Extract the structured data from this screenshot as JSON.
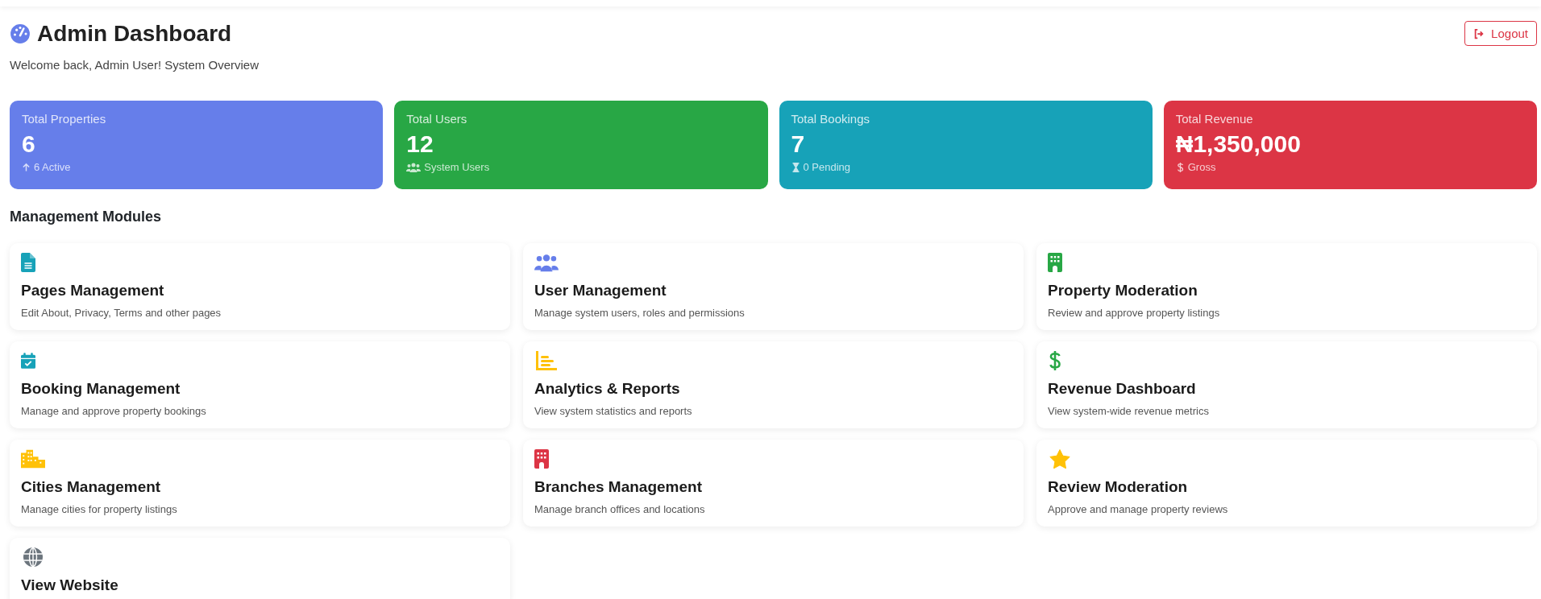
{
  "header": {
    "title": "Admin Dashboard",
    "subtitle": "Welcome back, Admin User! System Overview",
    "logout": "Logout"
  },
  "stats": [
    {
      "label": "Total Properties",
      "value": "6",
      "note": "6 Active",
      "kind": "arrow-up",
      "color": "#667eea"
    },
    {
      "label": "Total Users",
      "value": "12",
      "note": "System Users",
      "kind": "users",
      "color": "#28a745"
    },
    {
      "label": "Total Bookings",
      "value": "7",
      "note": "0 Pending",
      "kind": "hourglass",
      "color": "#17a2b8"
    },
    {
      "label": "Total Revenue",
      "value": "₦1,350,000",
      "note": "Gross",
      "kind": "dollar",
      "color": "#dc3545"
    }
  ],
  "modules_heading": "Management Modules",
  "modules": [
    {
      "title": "Pages Management",
      "description": "Edit About, Privacy, Terms and other pages",
      "kind": "file",
      "color": "#17a2b8"
    },
    {
      "title": "User Management",
      "description": "Manage system users, roles and permissions",
      "kind": "users",
      "color": "#667eea"
    },
    {
      "title": "Property Moderation",
      "description": "Review and approve property listings",
      "kind": "building",
      "color": "#28a745"
    },
    {
      "title": "Booking Management",
      "description": "Manage and approve property bookings",
      "kind": "calendar",
      "color": "#17a2b8"
    },
    {
      "title": "Analytics & Reports",
      "description": "View system statistics and reports",
      "kind": "chart",
      "color": "#ffc107"
    },
    {
      "title": "Revenue Dashboard",
      "description": "View system-wide revenue metrics",
      "kind": "dollar",
      "color": "#28a745"
    },
    {
      "title": "Cities Management",
      "description": "Manage cities for property listings",
      "kind": "city",
      "color": "#ffc107"
    },
    {
      "title": "Branches Management",
      "description": "Manage branch offices and locations",
      "kind": "building",
      "color": "#dc3545"
    },
    {
      "title": "Review Moderation",
      "description": "Approve and manage property reviews",
      "kind": "star",
      "color": "#ffc107"
    },
    {
      "title": "View Website",
      "kind": "globe",
      "color": "#6c757d"
    }
  ]
}
